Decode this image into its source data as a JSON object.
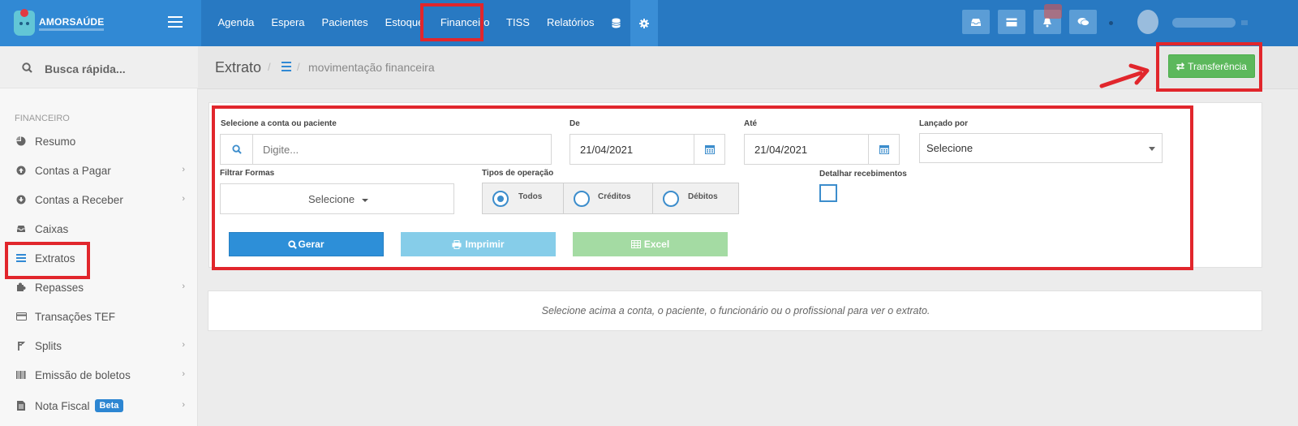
{
  "brand": {
    "name": "AMORSAÚDE"
  },
  "nav": {
    "items": [
      {
        "label": "Agenda"
      },
      {
        "label": "Espera"
      },
      {
        "label": "Pacientes"
      },
      {
        "label": "Estoque"
      },
      {
        "label": "Financeiro",
        "active": true
      },
      {
        "label": "TISS"
      },
      {
        "label": "Relatórios"
      }
    ],
    "icons": [
      "database-icon",
      "gear-icon"
    ]
  },
  "topbar_right": {
    "icons": [
      "inbox-icon",
      "card-icon",
      "bell-icon",
      "chat-icon"
    ]
  },
  "sidebar": {
    "search_label": "Busca rápida...",
    "section": "FINANCEIRO",
    "items": [
      {
        "label": "Resumo",
        "icon": "pie-chart-icon",
        "chevron": false
      },
      {
        "label": "Contas a Pagar",
        "icon": "arrow-up-circle-icon",
        "chevron": true
      },
      {
        "label": "Contas a Receber",
        "icon": "arrow-down-circle-icon",
        "chevron": true
      },
      {
        "label": "Caixas",
        "icon": "inbox-icon",
        "chevron": false
      },
      {
        "label": "Extratos",
        "icon": "list-icon",
        "chevron": false,
        "highlighted": true
      },
      {
        "label": "Repasses",
        "icon": "puzzle-icon",
        "chevron": true
      },
      {
        "label": "Transações TEF",
        "icon": "credit-card-icon",
        "chevron": false
      },
      {
        "label": "Splits",
        "icon": "split-icon",
        "chevron": true
      },
      {
        "label": "Emissão de boletos",
        "icon": "barcode-icon",
        "chevron": true
      },
      {
        "label": "Nota Fiscal",
        "icon": "file-icon",
        "chevron": true,
        "badge": "Beta"
      }
    ]
  },
  "header": {
    "title": "Extrato",
    "breadcrumb_sep": "/",
    "breadcrumb": "movimentação financeira",
    "transfer_label": "Transferência"
  },
  "filters": {
    "account_label": "Selecione a conta ou paciente",
    "account_placeholder": "Digite...",
    "from_label": "De",
    "from_value": "21/04/2021",
    "to_label": "Até",
    "to_value": "21/04/2021",
    "posted_by_label": "Lançado por",
    "posted_by_value": "Selecione",
    "forms_label": "Filtrar Formas",
    "forms_value": "Selecione",
    "op_types_label": "Tipos de operação",
    "op_types": [
      {
        "label": "Todos",
        "selected": true
      },
      {
        "label": "Créditos",
        "selected": false
      },
      {
        "label": "Débitos",
        "selected": false
      }
    ],
    "detail_label": "Detalhar recebimentos",
    "detail_checked": false
  },
  "actions": {
    "generate": "Gerar",
    "print": "Imprimir",
    "excel": "Excel"
  },
  "info": "Selecione acima a conta, o paciente, o funcionário ou o profissional para ver o extrato.",
  "colors": {
    "topbar": "#2879c2",
    "highlight": "#e1262c",
    "success": "#5cb85c",
    "primary": "#2d8fd8"
  }
}
